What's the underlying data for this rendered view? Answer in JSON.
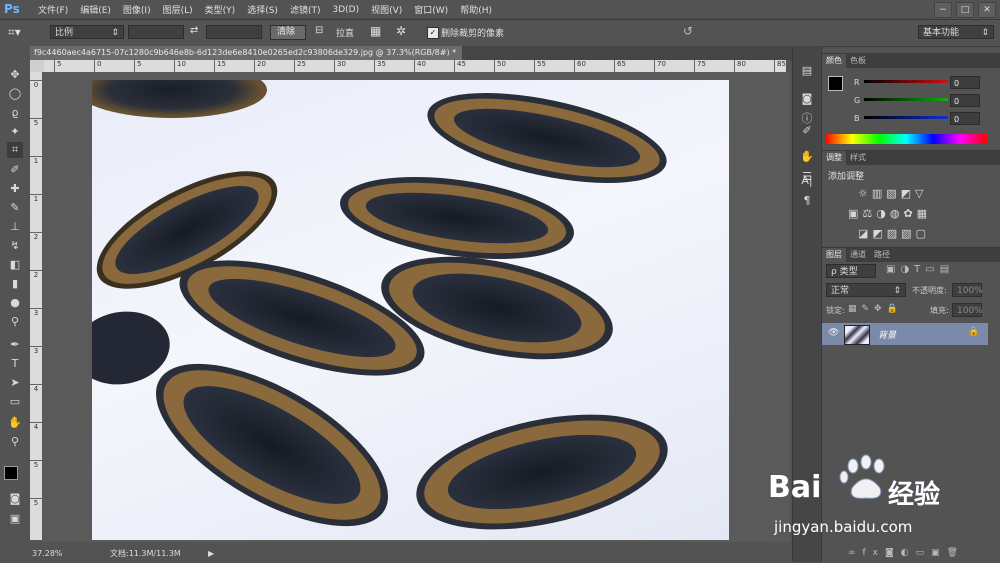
{
  "app": {
    "logo": "Ps"
  },
  "menu": [
    "文件(F)",
    "编辑(E)",
    "图像(I)",
    "图层(L)",
    "类型(Y)",
    "选择(S)",
    "滤镜(T)",
    "3D(D)",
    "视图(V)",
    "窗口(W)",
    "帮助(H)"
  ],
  "window_controls": [
    "−",
    "□",
    "✕"
  ],
  "options": {
    "ratio_value": "比例",
    "clear_label": "清除",
    "straighten_label": "拉直",
    "delete_cropped_label": "删除裁剪的像素",
    "workspace_value": "基本功能"
  },
  "document": {
    "tab_title": "f9c4460aec4a6715-07c1280c9b646e8b-6d123de6e8410e0265ed2c93806de329.jpg @ 37.3%(RGB/8#) *",
    "close": "×"
  },
  "ruler": {
    "h": [
      "5",
      "0",
      "5",
      "10",
      "15",
      "20",
      "25",
      "30",
      "35",
      "40",
      "45",
      "50",
      "55",
      "60",
      "65",
      "70",
      "75",
      "80",
      "85"
    ],
    "v": [
      "0",
      "5",
      "1",
      "1",
      "2",
      "2",
      "3",
      "3",
      "4",
      "4",
      "5",
      "5"
    ]
  },
  "status": {
    "zoom": "37.28%",
    "doc_info": "文档:11.3M/11.3M"
  },
  "color_panel": {
    "tabs": [
      "颜色",
      "色板"
    ],
    "channels": [
      {
        "label": "R",
        "value": "0",
        "color": "#d01010"
      },
      {
        "label": "G",
        "value": "0",
        "color": "#10b010"
      },
      {
        "label": "B",
        "value": "0",
        "color": "#1030d0"
      }
    ]
  },
  "adjustments_panel": {
    "tabs": [
      "调整",
      "样式"
    ],
    "title": "添加调整"
  },
  "layers_panel": {
    "tabs": [
      "图层",
      "通道",
      "路径"
    ],
    "filter_label": "ρ 类型",
    "blend_mode": "正常",
    "opacity_label": "不透明度:",
    "opacity_value": "100%",
    "lock_label": "锁定:",
    "fill_label": "填充:",
    "fill_value": "100%",
    "layer_name": "背景"
  },
  "watermark": {
    "brand_left": "Bai",
    "brand_right": "经验",
    "url": "jingyan.baidu.com"
  }
}
